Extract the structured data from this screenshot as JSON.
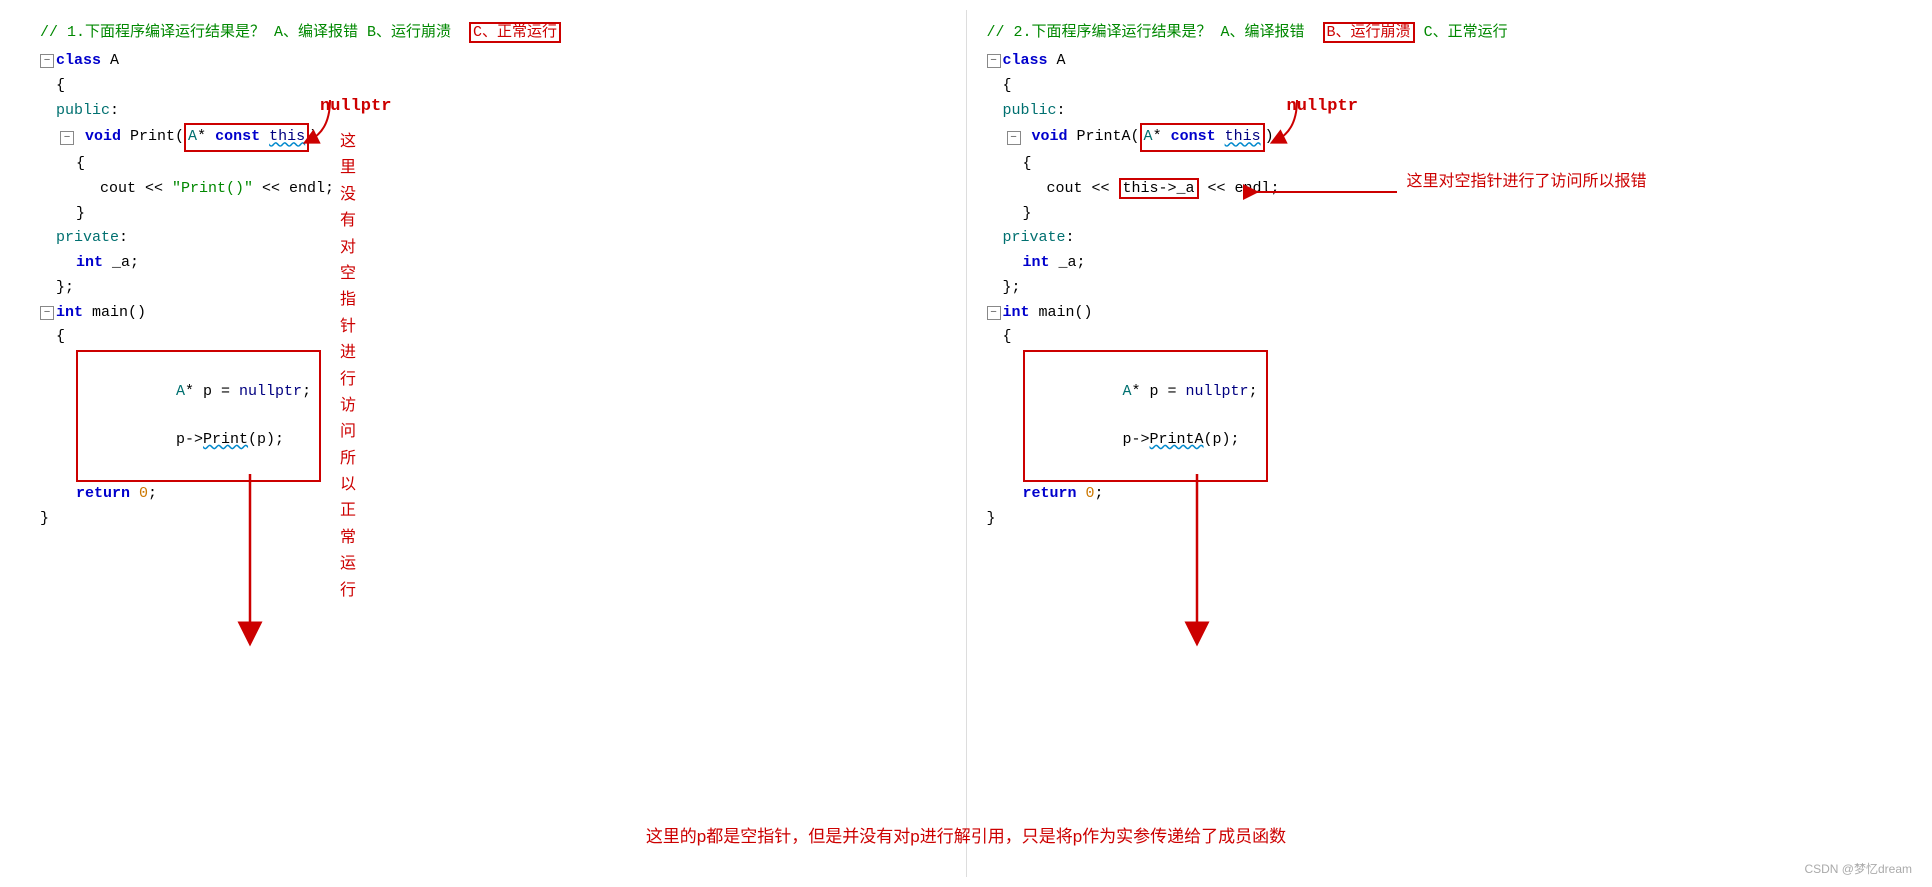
{
  "left": {
    "question": "// 1.下面程序编译运行结果是？  A、编译报错  B、运行崩溃",
    "question_highlight": "C、正常运行",
    "nullptr_label": "nullptr",
    "annotation1": "这里没有对空指针进行访问所以正常运行",
    "code": {
      "class_line": "class A",
      "open_brace": "{",
      "public_line": "public:",
      "void_print": "    void Print(",
      "a_const_this": "A* const this",
      "close_paren": ")",
      "open_brace2": "    {",
      "cout_line": "        cout << \"Print()\" << endl;",
      "close_brace2": "    }",
      "private_line": "private:",
      "int_a": "    int _a;",
      "close_class": "};",
      "int_main": "int main()",
      "open_main": "{",
      "code_box": "    A* p = nullptr;\n    p->Print(p);",
      "return_line": "    return 0;",
      "close_main": "}"
    }
  },
  "right": {
    "question": "// 2.下面程序编译运行结果是？  A、编译报错",
    "question_highlight": "B、运行崩溃",
    "question_rest": " C、正常运行",
    "nullptr_label": "nullptr",
    "annotation1": "这里对空指针进行了访问所以报错",
    "code": {
      "class_line": "class A",
      "open_brace": "{",
      "public_line": "public:",
      "void_printa": "    void PrintA(",
      "a_const_this": "A* const this",
      "close_paren": ")",
      "open_brace2": "    {",
      "cout_line": "        cout << ",
      "this_a": "this->_a",
      "cout_end": " << endl;",
      "close_brace2": "    }",
      "private_line": "private:",
      "int_a": "    int _a;",
      "close_class": "};",
      "int_main": "int main()",
      "open_main": "{",
      "code_box": "    A* p = nullptr;\n    p->PrintA(p);",
      "return_line": "    return 0;",
      "close_main": "}"
    }
  },
  "bottom_annotation": "这里的p都是空指针，但是并没有对p进行解引用，只是将p作为实参传递给了成员函数",
  "watermark": "CSDN @梦忆dream"
}
